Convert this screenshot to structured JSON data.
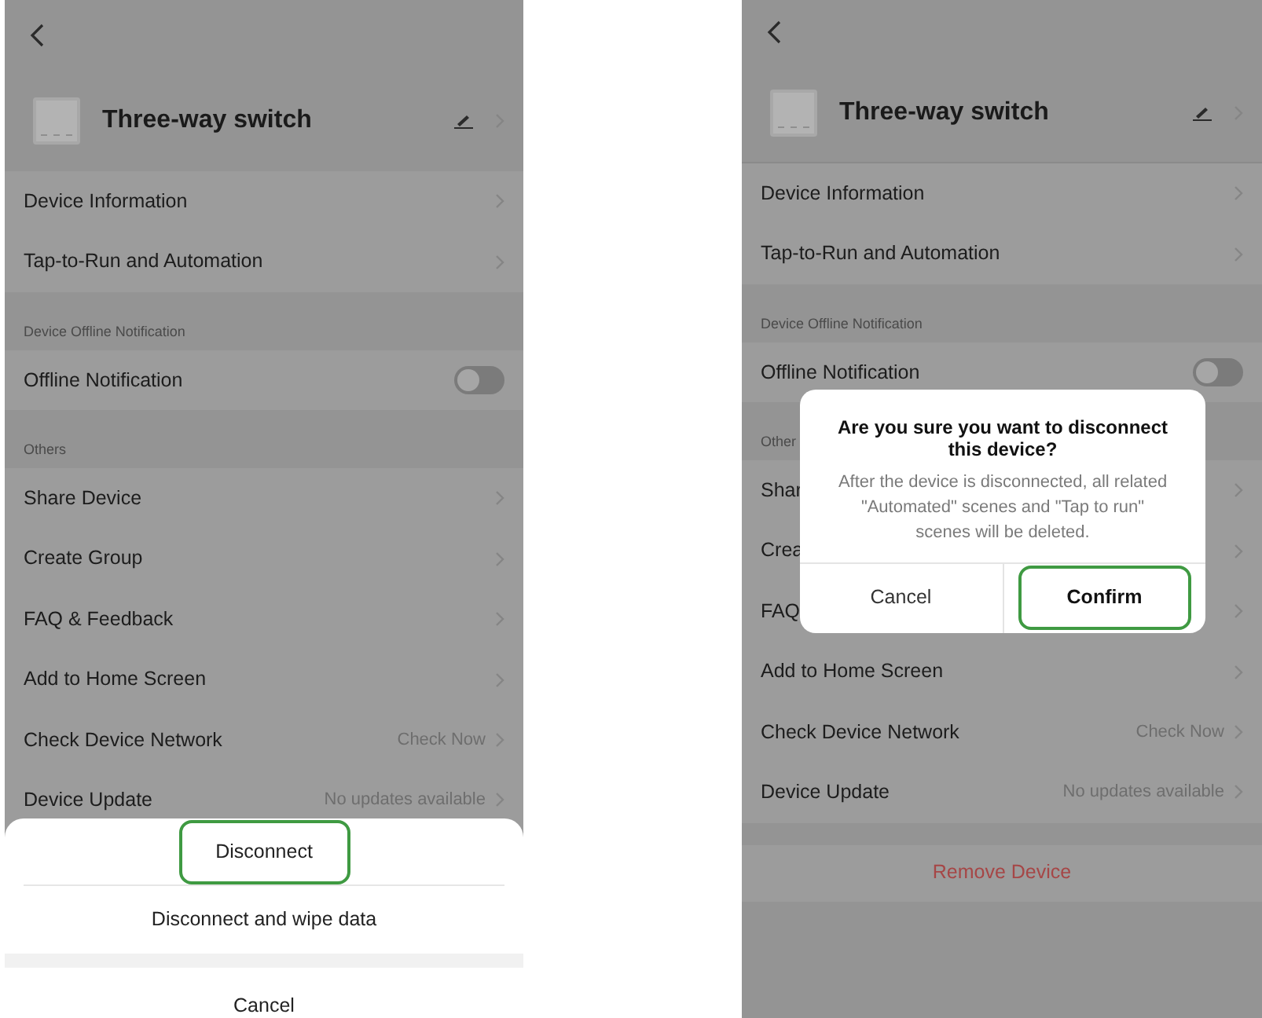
{
  "panels": [
    {
      "device_name": "Three-way switch",
      "groups": [
        {
          "rows": [
            {
              "kind": "link",
              "label": "Device Information"
            },
            {
              "kind": "link",
              "label": "Tap-to-Run and Automation"
            }
          ]
        },
        {
          "header": "Device Offline Notification",
          "rows": [
            {
              "kind": "toggle",
              "label": "Offline Notification",
              "on": false
            }
          ]
        },
        {
          "header": "Others",
          "rows": [
            {
              "kind": "link",
              "label": "Share Device"
            },
            {
              "kind": "link",
              "label": "Create Group"
            },
            {
              "kind": "link",
              "label": "FAQ & Feedback"
            },
            {
              "kind": "link",
              "label": "Add to Home Screen"
            },
            {
              "kind": "link",
              "label": "Check Device Network",
              "value": "Check Now"
            },
            {
              "kind": "link",
              "label": "Device Update",
              "value": "No updates available"
            }
          ]
        }
      ],
      "action_sheet": {
        "options": [
          {
            "label": "Disconnect",
            "highlighted": true
          },
          {
            "label": "Disconnect and wipe data",
            "highlighted": false
          }
        ],
        "cancel": "Cancel"
      }
    },
    {
      "device_name": "Three-way switch",
      "groups": [
        {
          "rows": [
            {
              "kind": "link",
              "label": "Device Information"
            },
            {
              "kind": "link",
              "label": "Tap-to-Run and Automation"
            }
          ]
        },
        {
          "header": "Device Offline Notification",
          "rows": [
            {
              "kind": "toggle",
              "label": "Offline Notification",
              "on": false
            }
          ]
        },
        {
          "header": "Other",
          "rows": [
            {
              "kind": "link",
              "label": "Shar"
            },
            {
              "kind": "link",
              "label": "Crea"
            },
            {
              "kind": "link",
              "label": "FAQ"
            },
            {
              "kind": "link",
              "label": "Add to Home Screen"
            },
            {
              "kind": "link",
              "label": "Check Device Network",
              "value": "Check Now"
            },
            {
              "kind": "link",
              "label": "Device Update",
              "value": "No updates available"
            }
          ]
        }
      ],
      "remove_button": "Remove Device",
      "dialog": {
        "title": "Are you sure you want to disconnect this device?",
        "message": "After the device is disconnected, all related \"Automated\" scenes and \"Tap to run\" scenes will be deleted.",
        "buttons": [
          {
            "kind": "cancel",
            "label": "Cancel",
            "highlighted": false
          },
          {
            "kind": "confirm",
            "label": "Confirm",
            "highlighted": true
          }
        ]
      }
    }
  ]
}
